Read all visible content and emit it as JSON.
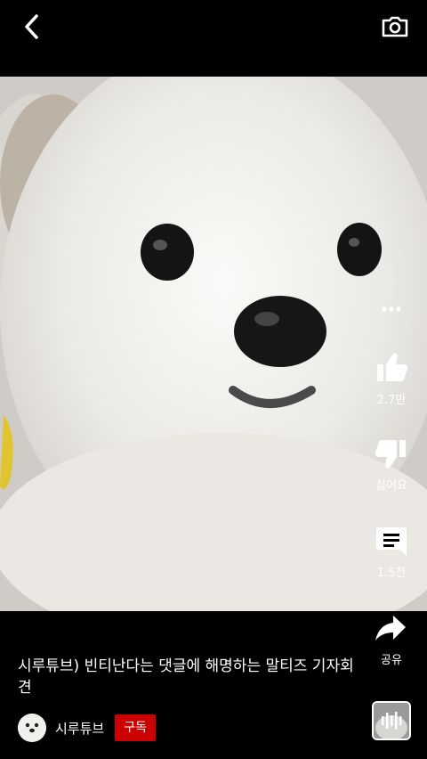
{
  "header": {
    "back_icon": "chevron-left-icon",
    "camera_icon": "camera-icon"
  },
  "actions": {
    "more_icon": "more-vert-icon",
    "like": {
      "icon": "thumb-up-icon",
      "label": "2.7만"
    },
    "dislike": {
      "icon": "thumb-down-icon",
      "label": "싫어요"
    },
    "comments": {
      "icon": "comment-icon",
      "label": "1.5천"
    },
    "share": {
      "icon": "share-arrow-icon",
      "label": "공유"
    }
  },
  "video": {
    "title": "시루튜브) 빈티난다는 댓글에 해명하는 말티즈 기자회견"
  },
  "channel": {
    "name": "시루튜브",
    "subscribe_label": "구독"
  },
  "colors": {
    "subscribe_red": "#cc0000",
    "background": "#000000"
  }
}
